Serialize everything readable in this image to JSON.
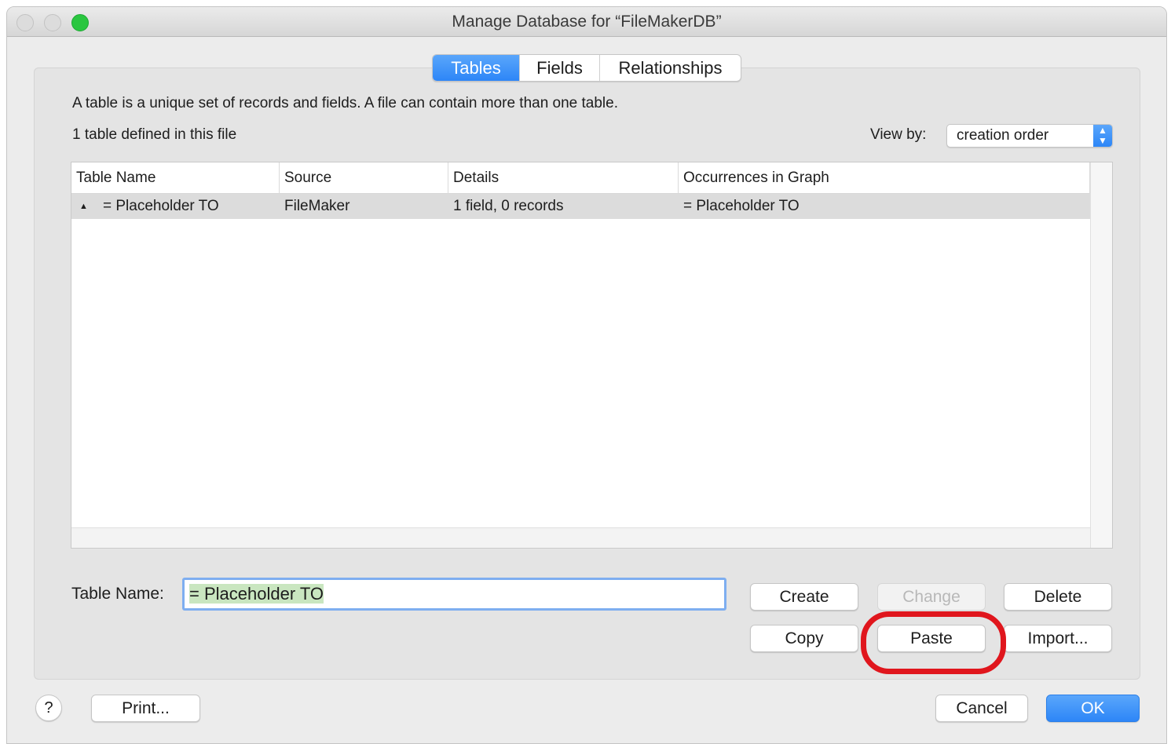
{
  "window": {
    "title": "Manage Database for “FileMakerDB”"
  },
  "tabs": [
    {
      "label": "Tables",
      "active": true
    },
    {
      "label": "Fields",
      "active": false
    },
    {
      "label": "Relationships",
      "active": false
    }
  ],
  "description": "A table is a unique set of records and fields. A file can contain more than one table.",
  "table_count": "1 table defined in this file",
  "view_by": {
    "label": "View by:",
    "value": "creation order"
  },
  "table": {
    "columns": [
      "Table Name",
      "Source",
      "Details",
      "Occurrences in Graph"
    ],
    "rows": [
      {
        "name": "= Placeholder TO",
        "source": "FileMaker",
        "details": "1 field, 0 records",
        "occurrences": "= Placeholder TO"
      }
    ]
  },
  "table_name": {
    "label": "Table Name:",
    "value": "= Placeholder TO"
  },
  "buttons": {
    "create": "Create",
    "change": "Change",
    "delete": "Delete",
    "copy": "Copy",
    "paste": "Paste",
    "import": "Import...",
    "print": "Print...",
    "cancel": "Cancel",
    "ok": "OK",
    "help": "?"
  },
  "colors": {
    "accent": "#2d86f7",
    "highlight_ring": "#e0161d",
    "selection_text_bg": "#c9e6c0"
  }
}
